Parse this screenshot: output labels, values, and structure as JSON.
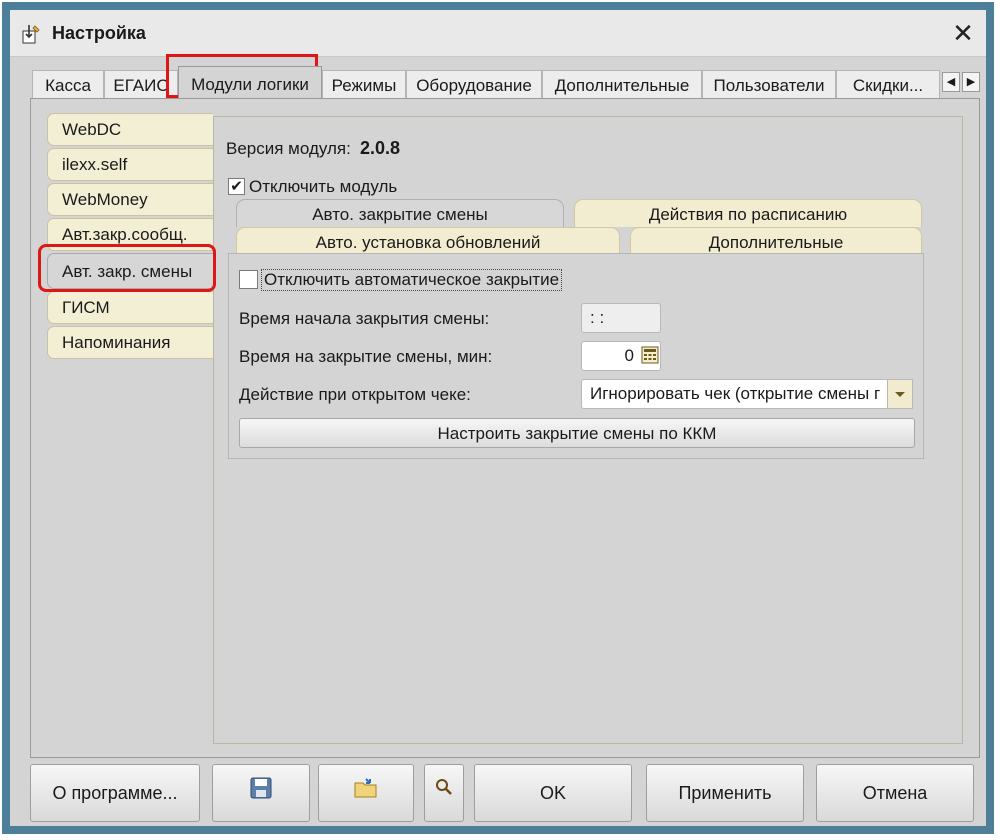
{
  "window": {
    "title": "Настройка"
  },
  "top_tabs": [
    "Касса",
    "ЕГАИС",
    "Модули логики",
    "Режимы",
    "Оборудование",
    "Дополнительные",
    "Пользователи",
    "Скидки..."
  ],
  "active_top_tab": "Модули логики",
  "side_tabs": [
    "WebDC",
    "ilexx.self",
    "WebMoney",
    "Авт.закр.сообщ.",
    "Авт. закр. смены",
    "ГИСМ",
    "Напоминания"
  ],
  "active_side_tab": "Авт. закр. смены",
  "module": {
    "version_label": "Версия модуля:",
    "version_value": "2.0.8",
    "disable_module_label": "Отключить модуль",
    "disable_module_checked": true
  },
  "sub_tabs": {
    "row1": [
      "Авто. закрытие смены",
      "Действия по расписанию"
    ],
    "row2": [
      "Авто. установка обновлений",
      "Дополнительные"
    ],
    "active": "Авто. закрытие смены"
  },
  "auto_close": {
    "disable_label": "Отключить автоматическое закрытие",
    "disable_checked": false,
    "start_time_label": "Время начала закрытия смены:",
    "start_time_value": " : :",
    "duration_label": "Время на закрытие смены, мин:",
    "duration_value": "0",
    "open_receipt_label": "Действие при открытом чеке:",
    "open_receipt_value": "Игнорировать чек (открытие смены г",
    "configure_button": "Настроить закрытие смены по ККМ"
  },
  "footer": {
    "about": "О программе...",
    "ok": "OK",
    "apply": "Применить",
    "cancel": "Отмена"
  },
  "colors": {
    "window_border": "#4d7f9b",
    "highlight": "#e01515",
    "side_tab_bg": "#f3efd4"
  }
}
